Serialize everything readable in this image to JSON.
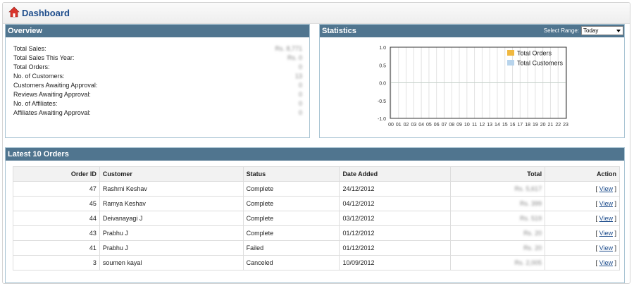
{
  "header": {
    "title": "Dashboard"
  },
  "overview": {
    "title": "Overview",
    "rows": [
      {
        "label": "Total Sales:",
        "value": "Rs. 8,771"
      },
      {
        "label": "Total Sales This Year:",
        "value": "Rs. 0"
      },
      {
        "label": "Total Orders:",
        "value": "0"
      },
      {
        "label": "No. of Customers:",
        "value": "13"
      },
      {
        "label": "Customers Awaiting Approval:",
        "value": "0"
      },
      {
        "label": "Reviews Awaiting Approval:",
        "value": "0"
      },
      {
        "label": "No. of Affiliates:",
        "value": "0"
      },
      {
        "label": "Affiliates Awaiting Approval:",
        "value": "0"
      }
    ]
  },
  "statistics": {
    "title": "Statistics",
    "range_label": "Select Range:",
    "range_value": "Today"
  },
  "chart_data": {
    "type": "line",
    "categories": [
      "00",
      "01",
      "02",
      "03",
      "04",
      "05",
      "06",
      "07",
      "08",
      "09",
      "10",
      "11",
      "12",
      "13",
      "14",
      "15",
      "16",
      "17",
      "18",
      "19",
      "20",
      "21",
      "22",
      "23"
    ],
    "series": [
      {
        "name": "Total Orders",
        "color": "#f0b840",
        "values": [
          0,
          0,
          0,
          0,
          0,
          0,
          0,
          0,
          0,
          0,
          0,
          0,
          0,
          0,
          0,
          0,
          0,
          0,
          0,
          0,
          0,
          0,
          0,
          0
        ]
      },
      {
        "name": "Total Customers",
        "color": "#b8d4ec",
        "values": [
          0,
          0,
          0,
          0,
          0,
          0,
          0,
          0,
          0,
          0,
          0,
          0,
          0,
          0,
          0,
          0,
          0,
          0,
          0,
          0,
          0,
          0,
          0,
          0
        ]
      }
    ],
    "yticks": [
      "1.0",
      "0.5",
      "0.0",
      "-0.5",
      "-1.0"
    ],
    "ylim": [
      -1,
      1
    ],
    "legend": "top-right",
    "grid": true
  },
  "orders": {
    "title": "Latest 10 Orders",
    "columns": {
      "order_id": "Order ID",
      "customer": "Customer",
      "status": "Status",
      "date": "Date Added",
      "total": "Total",
      "action": "Action"
    },
    "rows": [
      {
        "id": "47",
        "customer": "Rashmi Keshav",
        "status": "Complete",
        "date": "24/12/2012",
        "total": "Rs. 5,617",
        "action": "View"
      },
      {
        "id": "45",
        "customer": "Ramya Keshav",
        "status": "Complete",
        "date": "04/12/2012",
        "total": "Rs. 399",
        "action": "View"
      },
      {
        "id": "44",
        "customer": "Deivanayagi J",
        "status": "Complete",
        "date": "03/12/2012",
        "total": "Rs. 519",
        "action": "View"
      },
      {
        "id": "43",
        "customer": "Prabhu J",
        "status": "Complete",
        "date": "01/12/2012",
        "total": "Rs. 20",
        "action": "View"
      },
      {
        "id": "41",
        "customer": "Prabhu J",
        "status": "Failed",
        "date": "01/12/2012",
        "total": "Rs. 20",
        "action": "View"
      },
      {
        "id": "3",
        "customer": "soumen kayal",
        "status": "Canceled",
        "date": "10/09/2012",
        "total": "Rs. 2,005",
        "action": "View"
      }
    ]
  },
  "colors": {
    "header_bar": "#50758f",
    "title": "#1e4d8c",
    "border": "#a9c4d3"
  }
}
